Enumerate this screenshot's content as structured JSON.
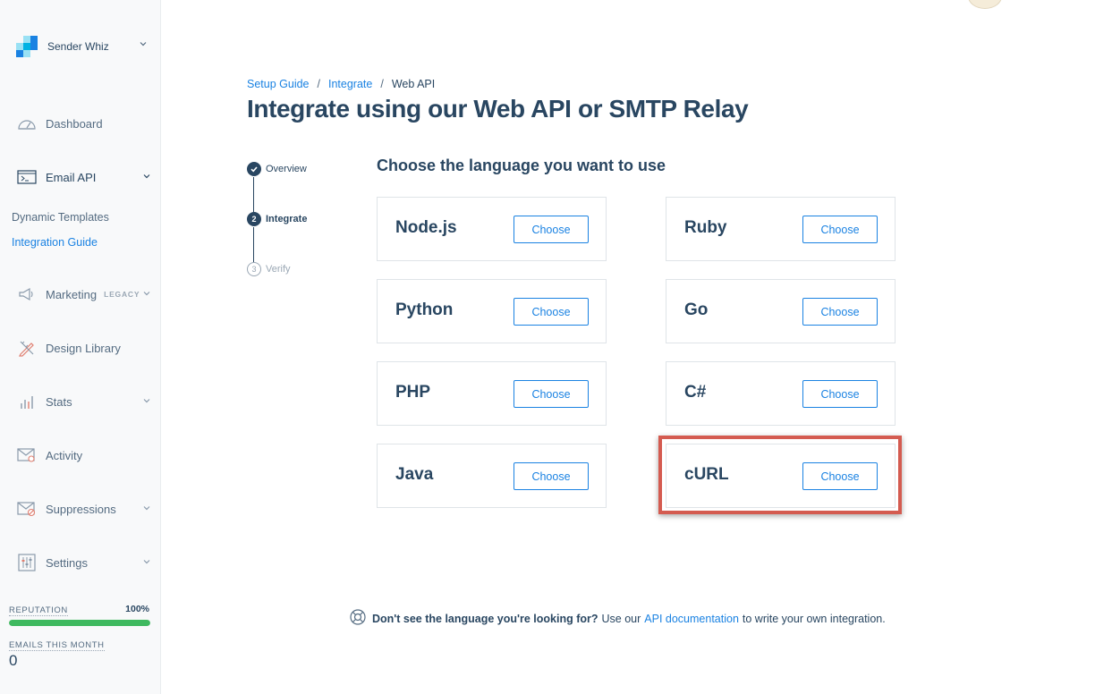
{
  "account": {
    "name": "Sender Whiz"
  },
  "nav": {
    "dashboard": "Dashboard",
    "email_api": "Email API",
    "email_api_children": [
      "Dynamic Templates",
      "Integration Guide"
    ],
    "marketing": "Marketing",
    "marketing_badge": "LEGACY",
    "design_library": "Design Library",
    "stats": "Stats",
    "activity": "Activity",
    "suppressions": "Suppressions",
    "settings": "Settings"
  },
  "reputation": {
    "label": "REPUTATION",
    "value": "100%",
    "fraction": 1.0,
    "color": "#3fb95f"
  },
  "emails_this_month": {
    "label": "EMAILS THIS MONTH",
    "value": "0"
  },
  "breadcrumb": {
    "items": [
      "Setup Guide",
      "Integrate"
    ],
    "current": "Web API",
    "separator": "/"
  },
  "title": "Integrate using our Web API or SMTP Relay",
  "steps": [
    {
      "number": "1",
      "label": "Overview",
      "state": "complete"
    },
    {
      "number": "2",
      "label": "Integrate",
      "state": "active"
    },
    {
      "number": "3",
      "label": "Verify",
      "state": "pending"
    }
  ],
  "heading": "Choose the language you want to use",
  "choose_label": "Choose",
  "languages": {
    "nodejs": "Node.js",
    "python": "Python",
    "php": "PHP",
    "java": "Java",
    "ruby": "Ruby",
    "go": "Go",
    "csharp": "C#",
    "curl": "cURL"
  },
  "help": {
    "question": "Don't see the language you're looking for?",
    "pre": "Use our",
    "link": "API documentation",
    "post": "to write your own integration."
  },
  "colors": {
    "accent": "#1a82e2",
    "text": "#294661",
    "highlight": "#d45b50"
  }
}
